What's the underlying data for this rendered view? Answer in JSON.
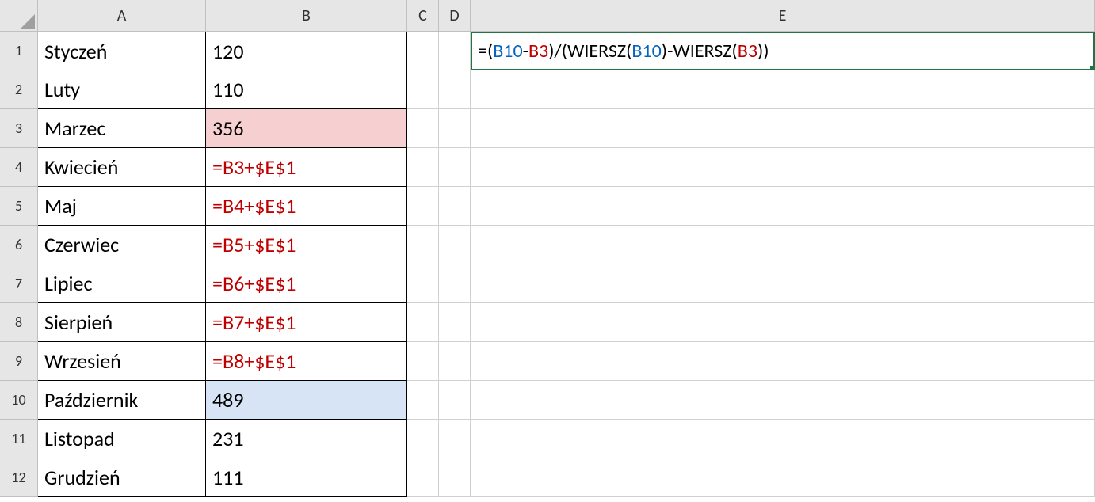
{
  "columns": [
    "A",
    "B",
    "C",
    "D",
    "E"
  ],
  "rowNumbers": [
    "1",
    "2",
    "3",
    "4",
    "5",
    "6",
    "7",
    "8",
    "9",
    "10",
    "11",
    "12"
  ],
  "rows": [
    {
      "A": "Styczeń",
      "B": "120",
      "bClass": ""
    },
    {
      "A": "Luty",
      "B": "110",
      "bClass": ""
    },
    {
      "A": "Marzec",
      "B": "356",
      "bClass": "highlight-red"
    },
    {
      "A": "Kwiecień",
      "B": "=B3+$E$1",
      "bClass": "red-formula"
    },
    {
      "A": "Maj",
      "B": "=B4+$E$1",
      "bClass": "red-formula"
    },
    {
      "A": "Czerwiec",
      "B": "=B5+$E$1",
      "bClass": "red-formula"
    },
    {
      "A": "Lipiec",
      "B": "=B6+$E$1",
      "bClass": "red-formula"
    },
    {
      "A": "Sierpień",
      "B": "=B7+$E$1",
      "bClass": "red-formula"
    },
    {
      "A": "Wrzesień",
      "B": "=B8+$E$1",
      "bClass": "red-formula"
    },
    {
      "A": "Październik",
      "B": "489",
      "bClass": "highlight-blue"
    },
    {
      "A": "Listopad",
      "B": "231",
      "bClass": ""
    },
    {
      "A": "Grudzień",
      "B": "111",
      "bClass": ""
    }
  ],
  "formulaE1": {
    "segments": [
      {
        "text": "=(",
        "cls": "c-black"
      },
      {
        "text": "B10",
        "cls": "c-blue"
      },
      {
        "text": "-",
        "cls": "c-black"
      },
      {
        "text": "B3",
        "cls": "c-red"
      },
      {
        "text": ")/(WIERSZ(",
        "cls": "c-black"
      },
      {
        "text": "B10",
        "cls": "c-blue"
      },
      {
        "text": ")-WIERSZ(",
        "cls": "c-black"
      },
      {
        "text": "B3",
        "cls": "c-red"
      },
      {
        "text": "))",
        "cls": "c-black"
      }
    ]
  }
}
